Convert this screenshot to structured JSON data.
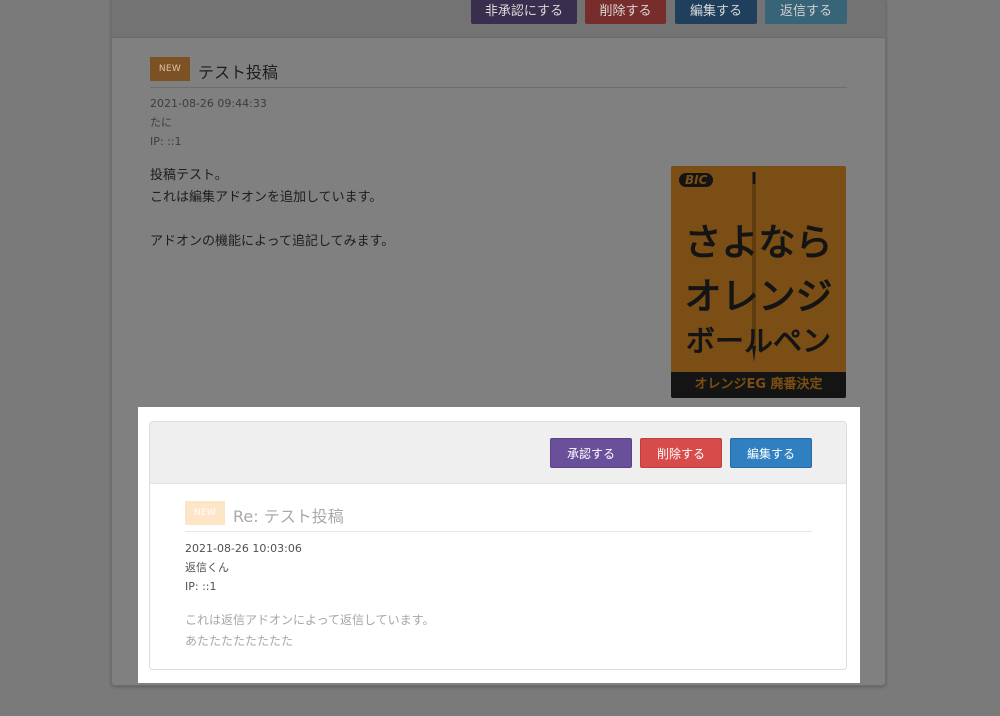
{
  "post": {
    "toolbar": {
      "unapprove_label": "非承認にする",
      "delete_label": "削除する",
      "edit_label": "編集する",
      "reply_label": "返信する"
    },
    "badge": "NEW",
    "title": "テスト投稿",
    "date": "2021-08-26 09:44:33",
    "author": "たに",
    "ip": "IP: ::1",
    "body_lines": [
      "投稿テスト。",
      "これは編集アドオンを追加しています。",
      "アドオンの機能によって追記してみます。"
    ]
  },
  "ad": {
    "logo": "BIC",
    "line1": "さよなら",
    "line2": "オレンジ",
    "line3": "ボールペン",
    "footer": "オレンジEG 廃番決定"
  },
  "reply": {
    "toolbar": {
      "approve_label": "承認する",
      "delete_label": "削除する",
      "edit_label": "編集する"
    },
    "badge": "NEW",
    "title": "Re: テスト投稿",
    "date": "2021-08-26 10:03:06",
    "author": "返信くん",
    "ip": "IP: ::1",
    "body_lines": [
      "これは返信アドオンによって返信しています。",
      "あたたたたたたたた"
    ]
  },
  "colors": {
    "overlay_bg": "#7a7a7a",
    "approve": "#6a4f9a",
    "delete": "#d84b4b",
    "edit": "#2f7fc1",
    "reply": "#5bc0de",
    "badge": "#f0ad4e"
  }
}
